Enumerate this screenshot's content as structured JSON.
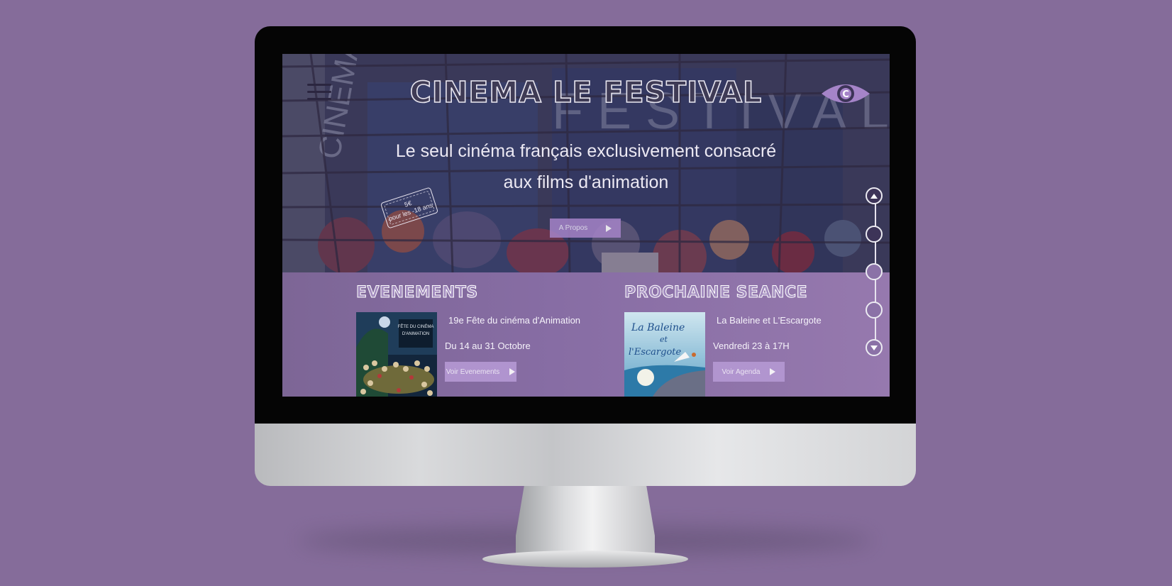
{
  "hero": {
    "title": "CINEMA LE FESTIVAL",
    "tagline_line1": "Le seul cinéma français exclusivement consacré",
    "tagline_line2": "aux films d'animation",
    "apropos_label": "A Propos",
    "ticket_price": "5€",
    "ticket_text": "pour les -18 ans",
    "building_letters": "CINEMA FESTIVAL"
  },
  "events": {
    "heading": "EVENEMENTS",
    "item_title": "19e Fête du cinéma d'Animation",
    "item_date": "Du 14 au 31 Octobre",
    "button_label": "Voir Evenements",
    "poster_text": "FÊTE DU CINÉMA D'ANIMATION"
  },
  "next_session": {
    "heading": "PROCHAINE SEANCE",
    "item_title": "La Baleine et L'Escargote",
    "item_date": "Vendredi 23 à 17H",
    "button_label": "Voir Agenda",
    "poster_text_1": "La Baleine",
    "poster_text_2": "et",
    "poster_text_3": "l'Escargote"
  },
  "vertical_nav": {
    "items": [
      "scroll-up",
      "section-1",
      "section-2",
      "section-3",
      "scroll-down"
    ]
  },
  "colors": {
    "background": "#856c9a",
    "accent": "#a584c8",
    "section_bg": "#876da4"
  }
}
